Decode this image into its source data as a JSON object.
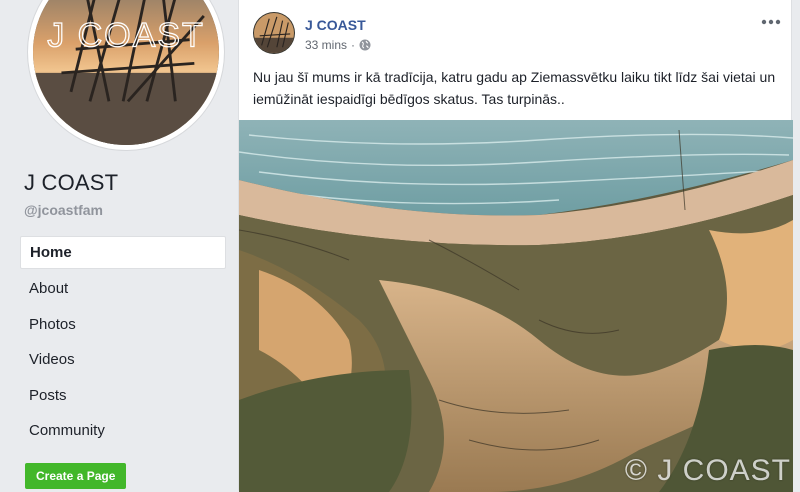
{
  "page": {
    "name": "J COAST",
    "handle": "@jcoastfam",
    "profile_logo_text": "J COAST"
  },
  "nav": {
    "items": [
      {
        "label": "Home",
        "active": true
      },
      {
        "label": "About"
      },
      {
        "label": "Photos"
      },
      {
        "label": "Videos"
      },
      {
        "label": "Posts"
      },
      {
        "label": "Community"
      }
    ]
  },
  "create_page_button": "Create a Page",
  "post": {
    "author": "J COAST",
    "timestamp": "33 mins",
    "separator": "·",
    "privacy_icon": "globe-icon",
    "text": "Nu jau šī mums ir kā tradīcija, katru gadu ap Ziemassvētku laiku tikt līdz šai vietai un iemūžināt iespaidīgi bēdīgos skatus. Tas turpinās..",
    "photo_watermark": "© J COAST"
  },
  "colors": {
    "background": "#e9ebee",
    "link_blue": "#385898",
    "green_button": "#42b72a"
  }
}
